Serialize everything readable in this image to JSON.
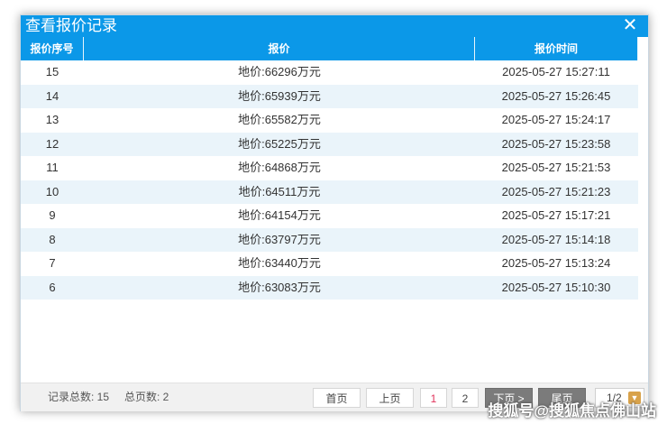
{
  "dialog": {
    "title": "查看报价记录",
    "close_icon": "close-icon"
  },
  "table": {
    "headers": [
      "报价序号",
      "报价",
      "报价时间"
    ],
    "rows": [
      {
        "index": "15",
        "price": "地价:66296万元",
        "time": "2025-05-27 15:27:11"
      },
      {
        "index": "14",
        "price": "地价:65939万元",
        "time": "2025-05-27 15:26:45"
      },
      {
        "index": "13",
        "price": "地价:65582万元",
        "time": "2025-05-27 15:24:17"
      },
      {
        "index": "12",
        "price": "地价:65225万元",
        "time": "2025-05-27 15:23:58"
      },
      {
        "index": "11",
        "price": "地价:64868万元",
        "time": "2025-05-27 15:21:53"
      },
      {
        "index": "10",
        "price": "地价:64511万元",
        "time": "2025-05-27 15:21:23"
      },
      {
        "index": "9",
        "price": "地价:64154万元",
        "time": "2025-05-27 15:17:21"
      },
      {
        "index": "8",
        "price": "地价:63797万元",
        "time": "2025-05-27 15:14:18"
      },
      {
        "index": "7",
        "price": "地价:63440万元",
        "time": "2025-05-27 15:13:24"
      },
      {
        "index": "6",
        "price": "地价:63083万元",
        "time": "2025-05-27 15:10:30"
      }
    ]
  },
  "footer": {
    "total_records": "记录总数: 15",
    "total_pages": "总页数: 2",
    "first": "首页",
    "prev": "上页",
    "page1": "1",
    "page2": "2",
    "next": "下页 >",
    "last": "尾页",
    "page_select": "1/2"
  },
  "watermark": "搜狐号@搜狐焦点佛山站",
  "colors": {
    "header_bg": "#0b98e8",
    "row_alt_bg": "#eaf4fa",
    "active_page": "#e0335b"
  }
}
